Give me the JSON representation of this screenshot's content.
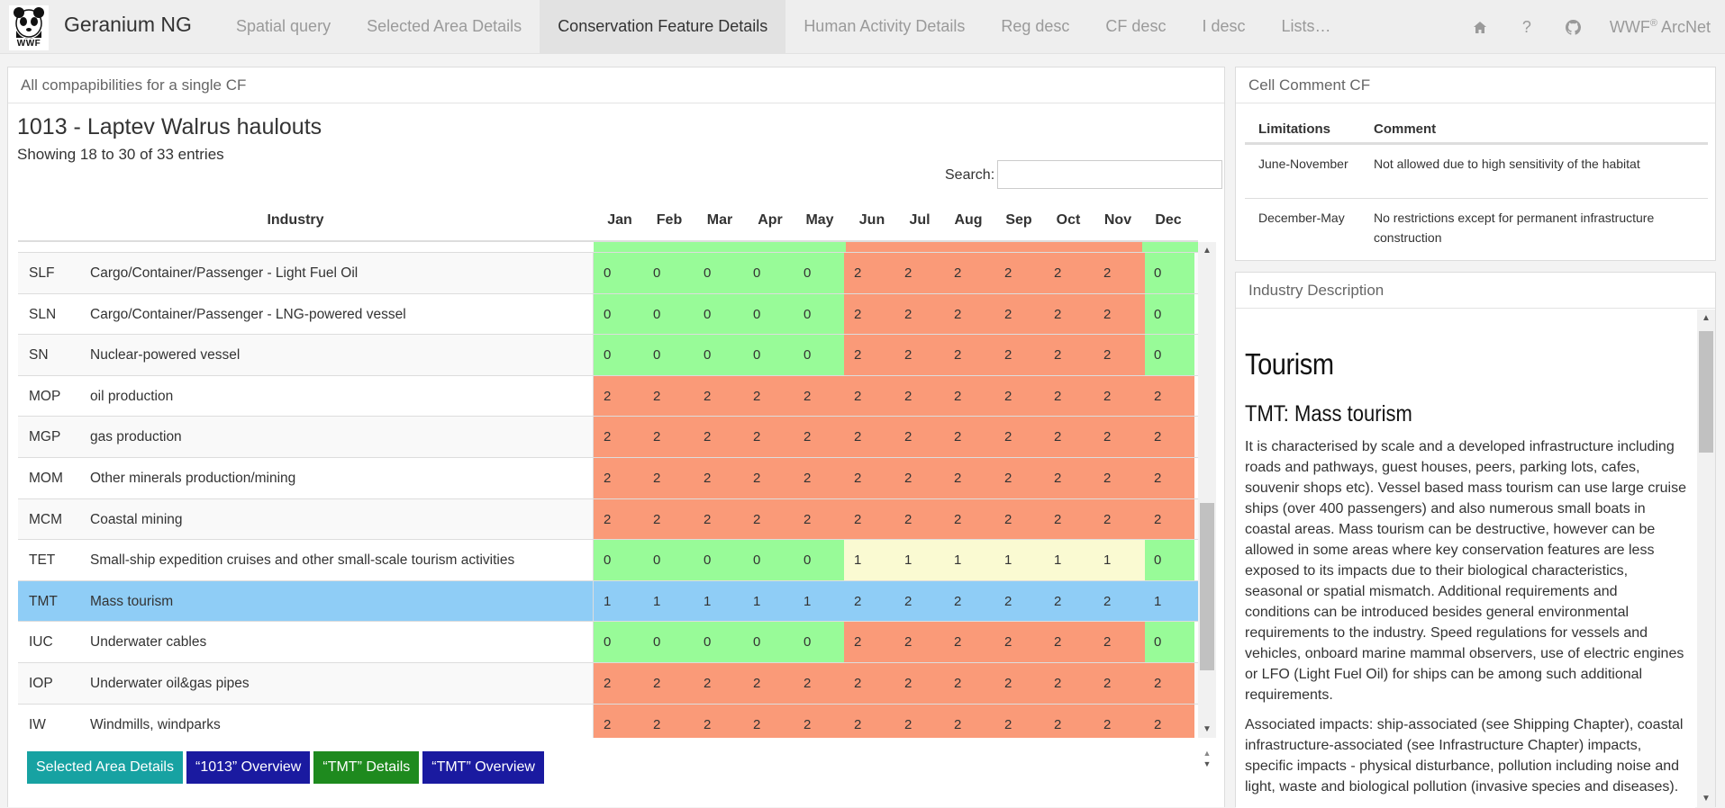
{
  "app": {
    "title": "Geranium NG",
    "logo_text": "WWF"
  },
  "nav": {
    "items": [
      {
        "label": "Spatial query",
        "active": false
      },
      {
        "label": "Selected Area Details",
        "active": false
      },
      {
        "label": "Conservation Feature Details",
        "active": true
      },
      {
        "label": "Human Activity Details",
        "active": false
      },
      {
        "label": "Reg desc",
        "active": false
      },
      {
        "label": "CF desc",
        "active": false
      },
      {
        "label": "I desc",
        "active": false
      },
      {
        "label": "Lists…",
        "active": false
      }
    ],
    "right_icons": [
      "home-icon",
      "help-icon",
      "github-icon"
    ],
    "brand_right": "WWF",
    "brand_right_mark": "®",
    "brand_right_suffix": "ArcNet"
  },
  "main_panel": {
    "heading": "All compapibilities for a single CF",
    "cf_title": "1013 - Laptev Walrus haulouts",
    "entries_info": "Showing 18 to 30 of 33 entries",
    "search_label": "Search:",
    "search_value": "",
    "columns": {
      "industry": "Industry",
      "months": [
        "Jan",
        "Feb",
        "Mar",
        "Apr",
        "May",
        "Jun",
        "Jul",
        "Aug",
        "Sep",
        "Oct",
        "Nov",
        "Dec"
      ]
    },
    "rows": [
      {
        "code": "SLF",
        "name": "Cargo/Container/Passenger - Light Fuel Oil",
        "values": [
          "0",
          "0",
          "0",
          "0",
          "0",
          "2",
          "2",
          "2",
          "2",
          "2",
          "2",
          "0"
        ],
        "selected": false
      },
      {
        "code": "SLN",
        "name": "Cargo/Container/Passenger - LNG-powered vessel",
        "values": [
          "0",
          "0",
          "0",
          "0",
          "0",
          "2",
          "2",
          "2",
          "2",
          "2",
          "2",
          "0"
        ],
        "selected": false
      },
      {
        "code": "SN",
        "name": "Nuclear-powered vessel",
        "values": [
          "0",
          "0",
          "0",
          "0",
          "0",
          "2",
          "2",
          "2",
          "2",
          "2",
          "2",
          "0"
        ],
        "selected": false
      },
      {
        "code": "MOP",
        "name": "oil production",
        "values": [
          "2",
          "2",
          "2",
          "2",
          "2",
          "2",
          "2",
          "2",
          "2",
          "2",
          "2",
          "2"
        ],
        "selected": false
      },
      {
        "code": "MGP",
        "name": "gas production",
        "values": [
          "2",
          "2",
          "2",
          "2",
          "2",
          "2",
          "2",
          "2",
          "2",
          "2",
          "2",
          "2"
        ],
        "selected": false
      },
      {
        "code": "MOM",
        "name": "Other minerals production/mining",
        "values": [
          "2",
          "2",
          "2",
          "2",
          "2",
          "2",
          "2",
          "2",
          "2",
          "2",
          "2",
          "2"
        ],
        "selected": false
      },
      {
        "code": "MCM",
        "name": "Coastal mining",
        "values": [
          "2",
          "2",
          "2",
          "2",
          "2",
          "2",
          "2",
          "2",
          "2",
          "2",
          "2",
          "2"
        ],
        "selected": false
      },
      {
        "code": "TET",
        "name": "Small-ship expedition cruises and other small-scale tourism activities",
        "values": [
          "0",
          "0",
          "0",
          "0",
          "0",
          "1",
          "1",
          "1",
          "1",
          "1",
          "1",
          "0"
        ],
        "selected": false
      },
      {
        "code": "TMT",
        "name": "Mass tourism",
        "values": [
          "1",
          "1",
          "1",
          "1",
          "1",
          "2",
          "2",
          "2",
          "2",
          "2",
          "2",
          "1"
        ],
        "selected": true
      },
      {
        "code": "IUC",
        "name": "Underwater cables",
        "values": [
          "0",
          "0",
          "0",
          "0",
          "0",
          "2",
          "2",
          "2",
          "2",
          "2",
          "2",
          "0"
        ],
        "selected": false
      },
      {
        "code": "IOP",
        "name": "Underwater oil&gas pipes",
        "values": [
          "2",
          "2",
          "2",
          "2",
          "2",
          "2",
          "2",
          "2",
          "2",
          "2",
          "2",
          "2"
        ],
        "selected": false
      },
      {
        "code": "IW",
        "name": "Windmills, windparks",
        "values": [
          "2",
          "2",
          "2",
          "2",
          "2",
          "2",
          "2",
          "2",
          "2",
          "2",
          "2",
          "2"
        ],
        "selected": false
      }
    ],
    "value_colors": {
      "0": "#98fb98",
      "1": "#fafad2",
      "2": "#fa9a78",
      "selected": "#8fcdf6"
    },
    "buttons": [
      {
        "label": "Selected Area Details",
        "style": "teal"
      },
      {
        "label": "“1013” Overview",
        "style": "navy"
      },
      {
        "label": "“TMT” Details",
        "style": "green"
      },
      {
        "label": "“TMT” Overview",
        "style": "navy"
      }
    ]
  },
  "cf_comment": {
    "heading": "Cell Comment CF",
    "col_limitations": "Limitations",
    "col_comment": "Comment",
    "rows": [
      {
        "limitations": "June-November",
        "comment": "Not allowed due to high sensitivity of the habitat"
      },
      {
        "limitations": "December-May",
        "comment": "No restrictions except for permanent infrastructure construction"
      }
    ]
  },
  "industry_description": {
    "heading": "Industry Description",
    "h1": "Tourism",
    "h2": "TMT: Mass tourism",
    "paragraphs": [
      "It is characterised by scale and a developed infrastructure including roads and pathways, guest houses, peers, parking lots, cafes, souvenir shops etc). Vessel based mass tourism can use large cruise ships (over 400 passengers) and also numerous small boats in coastal areas. Mass tourism can be destructive, however can be allowed in some areas where key conservation features are less exposed to its impacts due to their biological characteristics, seasonal or spatial mismatch. Additional requirements and conditions can be introduced besides general environmental requirements to the industry. Speed regulations for vessels and vehicles, onboard marine mammal observers, use of electric engines or LFO (Light Fuel Oil) for ships can be among such additional requirements.",
      "Associated impacts: ship-associated (see Shipping Chapter), coastal infrastructure-associated (see Infrastructure Chapter) impacts, specific impacts - physical disturbance, pollution including noise and light, waste and biological pollution (invasive species and diseases)."
    ]
  }
}
